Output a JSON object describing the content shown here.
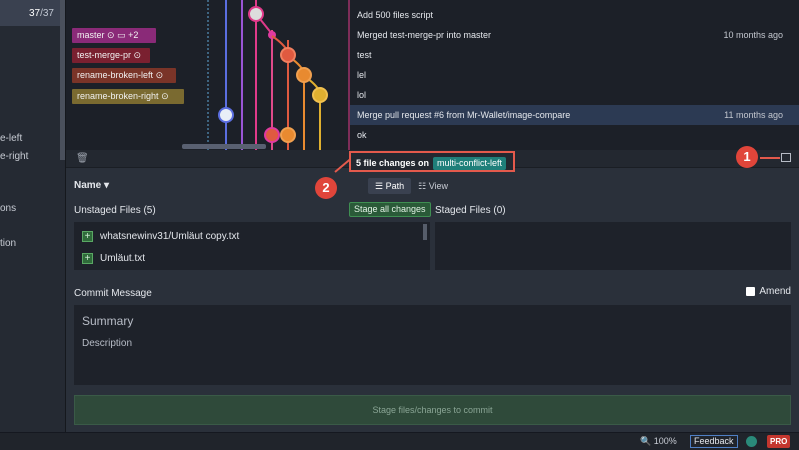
{
  "sidebar": {
    "count_current": "37",
    "count_sep": "/",
    "count_total": "37",
    "items": [
      "e-left",
      "e-right",
      "ons",
      "tion"
    ]
  },
  "graph": {
    "rows": [
      {
        "message": "Add 500 files script",
        "time": ""
      },
      {
        "message": "Merged test-merge-pr into master",
        "time": "10 months ago"
      },
      {
        "message": "test",
        "time": ""
      },
      {
        "message": "lel",
        "time": ""
      },
      {
        "message": "lol",
        "time": ""
      },
      {
        "message": "Merge pull request #6 from Mr-Wallet/image-compare",
        "time": "11 months ago"
      },
      {
        "message": "ok",
        "time": ""
      }
    ],
    "branches": [
      {
        "label": "master",
        "extra": "+2",
        "color": "#8a2a78"
      },
      {
        "label": "test-merge-pr",
        "color": "#7a2030"
      },
      {
        "label": "rename-broken-left",
        "color": "#7a3428"
      },
      {
        "label": "rename-broken-right",
        "color": "#7a6a30"
      }
    ]
  },
  "panel": {
    "changes_count": "5 file changes on",
    "changes_branch": "multi-conflict-left",
    "sort_label": "Name",
    "view_path": "Path",
    "view_tree": "View",
    "unstaged_title": "Unstaged Files (5)",
    "stage_all": "Stage all changes",
    "staged_title": "Staged Files (0)",
    "files": [
      "whatsnewinv31/Umläut copy.txt",
      "Umläut.txt"
    ],
    "commit_title": "Commit Message",
    "amend_label": "Amend",
    "summary_placeholder": "Summary",
    "description_placeholder": "Description",
    "commit_button": "Stage files/changes to commit"
  },
  "callouts": {
    "one": "1",
    "two": "2"
  },
  "status": {
    "zoom": "100%",
    "feedback": "Feedback",
    "pro": "PRO"
  },
  "colors": {
    "accent": "#1f7f7a",
    "callout": "#e0453a"
  }
}
